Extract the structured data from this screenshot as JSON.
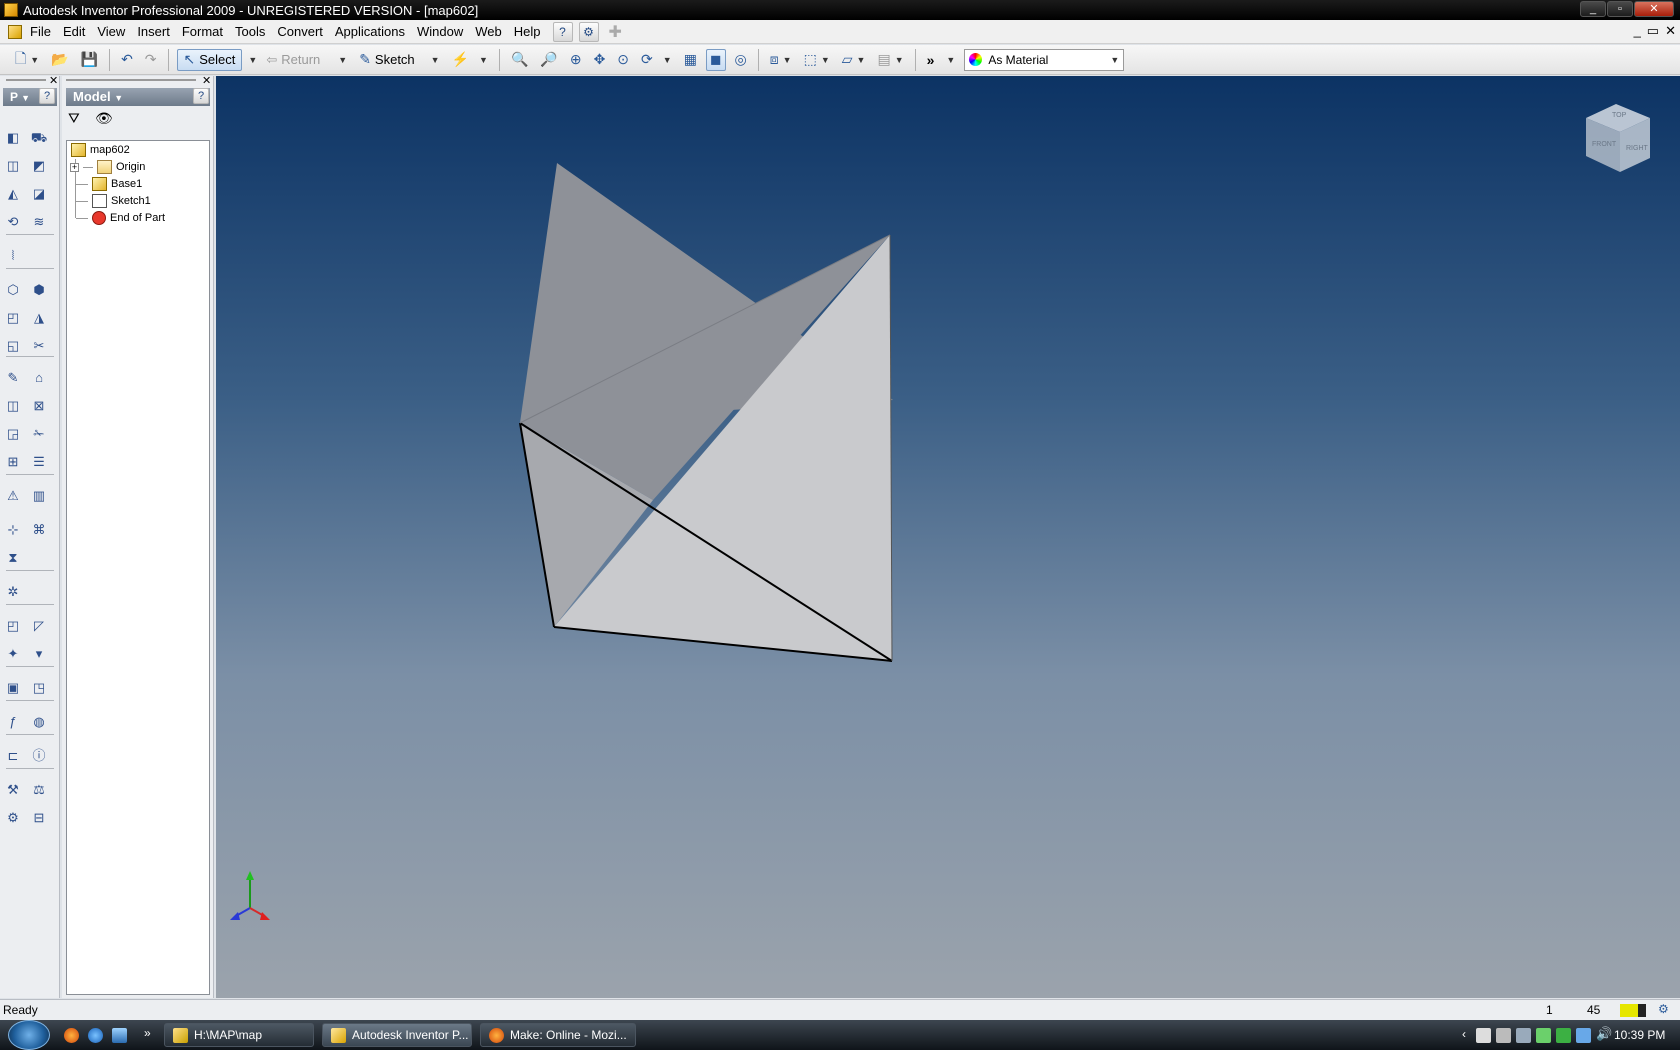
{
  "window": {
    "title": "Autodesk Inventor Professional 2009 - UNREGISTERED VERSION - [map602]",
    "controls": [
      "_",
      "▫",
      "✕"
    ]
  },
  "menu": {
    "items": [
      "File",
      "Edit",
      "View",
      "Insert",
      "Format",
      "Tools",
      "Convert",
      "Applications",
      "Window",
      "Web",
      "Help"
    ]
  },
  "toolbar": {
    "select_label": "Select",
    "return_label": "Return",
    "sketch_label": "Sketch",
    "material_value": "As Material"
  },
  "panelbar": {
    "header_label": "P",
    "help_glyph": "?"
  },
  "browser": {
    "header_label": "Model",
    "help_glyph": "?",
    "expand_glyph": "+",
    "tree": [
      {
        "label": "map602",
        "icon": "part-icon"
      },
      {
        "label": "Origin",
        "icon": "folder-icon"
      },
      {
        "label": "Base1",
        "icon": "extrusion-icon"
      },
      {
        "label": "Sketch1",
        "icon": "sketch-icon"
      },
      {
        "label": "End of Part",
        "icon": "end-of-part-icon"
      }
    ]
  },
  "viewcube": {
    "faces": [
      "TOP",
      "FRONT",
      "RIGHT"
    ]
  },
  "status": {
    "text": "Ready",
    "count_a": "1",
    "count_b": "45"
  },
  "taskbar": {
    "tasks": [
      "H:\\MAP\\map",
      "Autodesk Inventor P...",
      "Make: Online - Mozi..."
    ],
    "time": "10:39 PM"
  },
  "colors": {
    "viewport_top": "#0c3364",
    "viewport_bottom": "#9ba3ac",
    "solid_dark": "#8e9198",
    "solid_light": "#c9cacd"
  }
}
